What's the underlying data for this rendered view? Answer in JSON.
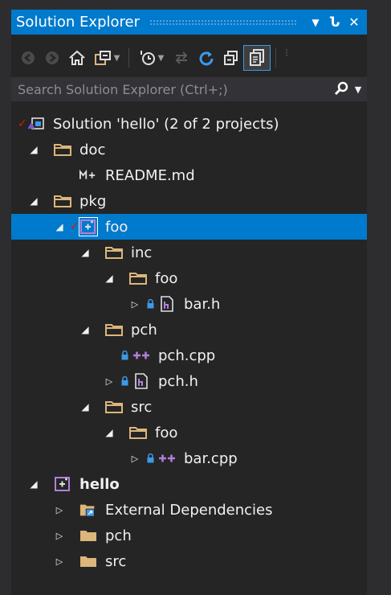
{
  "panel": {
    "title": "Solution Explorer",
    "pin_glyph": "Ն",
    "dropdown_glyph": "▼",
    "close_glyph": "✕"
  },
  "toolbar": {
    "icons": [
      "back-icon",
      "forward-icon",
      "home-icon",
      "switch-views-icon",
      "pending-changes-filter-icon",
      "sync-with-active-document-icon",
      "refresh-icon",
      "collapse-all-icon",
      "show-all-files-icon"
    ]
  },
  "search": {
    "placeholder": "Search Solution Explorer (Ctrl+;)",
    "value": ""
  },
  "tree": [
    {
      "label": "Solution 'hello' (2 of 2 projects)",
      "icon": "solution-icon",
      "level": 0,
      "expander": "none",
      "check": true
    },
    {
      "label": "doc",
      "icon": "folder-icon",
      "level": 1,
      "expander": "open"
    },
    {
      "label": "README.md",
      "icon": "markdown-icon",
      "level": 2,
      "expander": "none"
    },
    {
      "label": "pkg",
      "icon": "folder-icon",
      "level": 1,
      "expander": "open"
    },
    {
      "label": "foo",
      "icon": "project-icon",
      "level": 2,
      "expander": "open",
      "check": true,
      "selected": true
    },
    {
      "label": "inc",
      "icon": "folder-icon",
      "level": 3,
      "expander": "open"
    },
    {
      "label": "foo",
      "icon": "folder-icon",
      "level": 4,
      "expander": "open"
    },
    {
      "label": "bar.h",
      "icon": "header-file-icon",
      "level": 5,
      "expander": "closed",
      "lock": true
    },
    {
      "label": "pch",
      "icon": "folder-icon",
      "level": 3,
      "expander": "open"
    },
    {
      "label": "pch.cpp",
      "icon": "cpp-file-icon",
      "level": 4,
      "expander": "none",
      "lock": true
    },
    {
      "label": "pch.h",
      "icon": "header-file-icon",
      "level": 4,
      "expander": "closed",
      "lock": true
    },
    {
      "label": "src",
      "icon": "folder-icon",
      "level": 3,
      "expander": "open"
    },
    {
      "label": "foo",
      "icon": "folder-icon",
      "level": 4,
      "expander": "open"
    },
    {
      "label": "bar.cpp",
      "icon": "cpp-file-icon",
      "level": 5,
      "expander": "closed",
      "lock": true
    },
    {
      "label": "hello",
      "icon": "project-icon",
      "level": 1,
      "expander": "open",
      "bold": true
    },
    {
      "label": "External Dependencies",
      "icon": "external-dependencies-icon",
      "level": 2,
      "expander": "closed"
    },
    {
      "label": "pch",
      "icon": "filter-folder-icon",
      "level": 2,
      "expander": "closed"
    },
    {
      "label": "src",
      "icon": "filter-folder-icon",
      "level": 2,
      "expander": "closed"
    }
  ],
  "colors": {
    "accent": "#007acc",
    "background": "#252526",
    "folder": "#dcb67a",
    "cpp": "#b180d7",
    "check": "#e51400",
    "lock": "#3c9ae8"
  }
}
